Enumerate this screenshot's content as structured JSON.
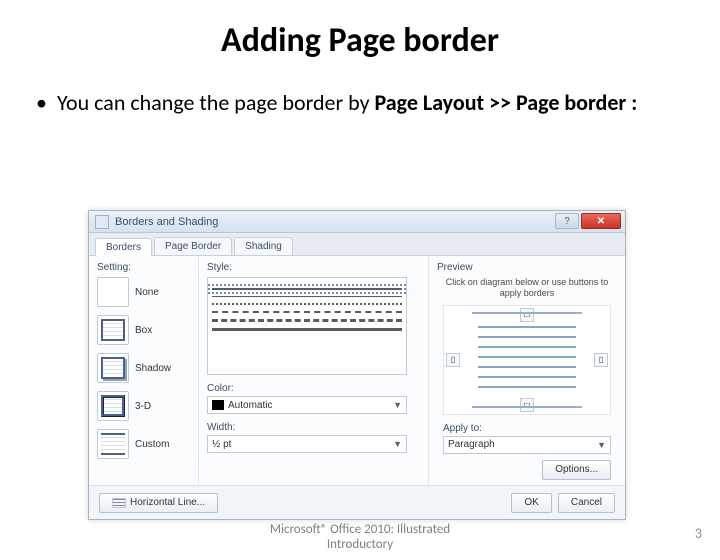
{
  "title": "Adding Page border",
  "bullet": {
    "prefix": "You can change the page border by ",
    "bold": "Page Layout >> Page border :"
  },
  "dialog": {
    "title": "Borders and Shading",
    "help_text": "?",
    "close_text": "✕",
    "tabs": {
      "borders": "Borders",
      "page_border": "Page Border",
      "shading": "Shading"
    },
    "sections": {
      "setting": "Setting:",
      "style": "Style:",
      "color": "Color:",
      "width": "Width:",
      "preview": "Preview",
      "apply_to": "Apply to:"
    },
    "settings": {
      "none": "None",
      "box": "Box",
      "shadow": "Shadow",
      "three_d": "3-D",
      "custom": "Custom"
    },
    "color_value": "Automatic",
    "width_value": "½ pt",
    "preview_hint": "Click on diagram below or use buttons to apply borders",
    "apply_to_value": "Paragraph",
    "options_btn": "Options...",
    "horizontal_line_btn": "Horizontal Line...",
    "ok_btn": "OK",
    "cancel_btn": "Cancel"
  },
  "footer_caption_line1": "Microsoft® Office 2010: Illustrated",
  "footer_caption_line2": "Introductory",
  "page_number": "3"
}
